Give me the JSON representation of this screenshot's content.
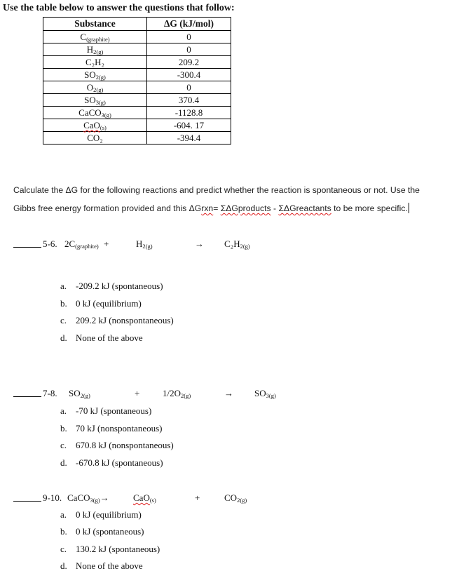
{
  "heading": "Use the table below to answer the questions that follow:",
  "table": {
    "headers": [
      "Substance",
      "ΔG (kJ/mol)"
    ],
    "rows": [
      {
        "base": "C",
        "sub": "(graphite)",
        "value": "0"
      },
      {
        "base": "H",
        "sub": "2(g)",
        "value": "0"
      },
      {
        "base": "C₂H₂",
        "sub": "",
        "value": "209.2"
      },
      {
        "base": "SO",
        "sub": "2(g)",
        "value": "-300.4"
      },
      {
        "base": "O",
        "sub": "2(g)",
        "value": "0"
      },
      {
        "base": "SO",
        "sub": "3(g)",
        "value": "370.4"
      },
      {
        "base": "CaCO",
        "sub": "3(g)",
        "value": "-1128.8"
      },
      {
        "base": "CaO",
        "sub": "(s)",
        "value": "-604. 17"
      },
      {
        "base": "CO₂",
        "sub": "",
        "value": "-394.4"
      }
    ]
  },
  "instructions": {
    "line1": "Calculate the ΔG for the following reactions and predict whether the reaction is spontaneous or not. Use the",
    "line2_a": "Gibbs free energy formation provided and this ΔG",
    "line2_b": "rxn",
    "line2_c": "= ",
    "line2_d": "ΣΔGproducts",
    "line2_e": " - ",
    "line2_f": "ΣΔGreactants",
    "line2_g": " to be more specific."
  },
  "questions": [
    {
      "number": "5-6.",
      "equation": {
        "r1": "2C",
        "r1_sub": "(graphite)",
        "plus1": "+",
        "r2": "H",
        "r2_sub": "2(g)",
        "arrow": "→",
        "p1": "C₂H",
        "p1_sub": "2(g)"
      },
      "options": [
        {
          "letter": "a.",
          "text": "-209.2 kJ (spontaneous)"
        },
        {
          "letter": "b.",
          "text": "0 kJ (equilibrium)"
        },
        {
          "letter": "c.",
          "text": "209.2 kJ (nonspontaneous)"
        },
        {
          "letter": "d.",
          "text": "None of the above"
        }
      ]
    },
    {
      "number": "7-8.",
      "equation": {
        "r1": "SO",
        "r1_sub": "2(g)",
        "plus1": "+",
        "r2": "1/2O",
        "r2_sub": "2(g)",
        "arrow": "→",
        "p1": "SO",
        "p1_sub": "3(g)"
      },
      "options": [
        {
          "letter": "a.",
          "text": "-70 kJ (spontaneous)"
        },
        {
          "letter": "b.",
          "text": "70 kJ (nonspontaneous)"
        },
        {
          "letter": "c.",
          "text": "670.8 kJ (nonspontaneous)"
        },
        {
          "letter": "d.",
          "text": "-670.8 kJ (spontaneous)"
        }
      ]
    },
    {
      "number": "9-10.",
      "equation": {
        "r1": "CaCO",
        "r1_sub": "3(g)",
        "arrow": "→",
        "p1": "CaO",
        "p1_sub": "(s)",
        "plus1": "+",
        "p2": "CO",
        "p2_sub": "2(g)"
      },
      "options": [
        {
          "letter": "a.",
          "text": "0 kJ (equilibrium)"
        },
        {
          "letter": "b.",
          "text": "0 kJ (spontaneous)"
        },
        {
          "letter": "c.",
          "text": "130.2 kJ (spontaneous)"
        },
        {
          "letter": "d.",
          "text": "None of the above"
        }
      ]
    }
  ]
}
